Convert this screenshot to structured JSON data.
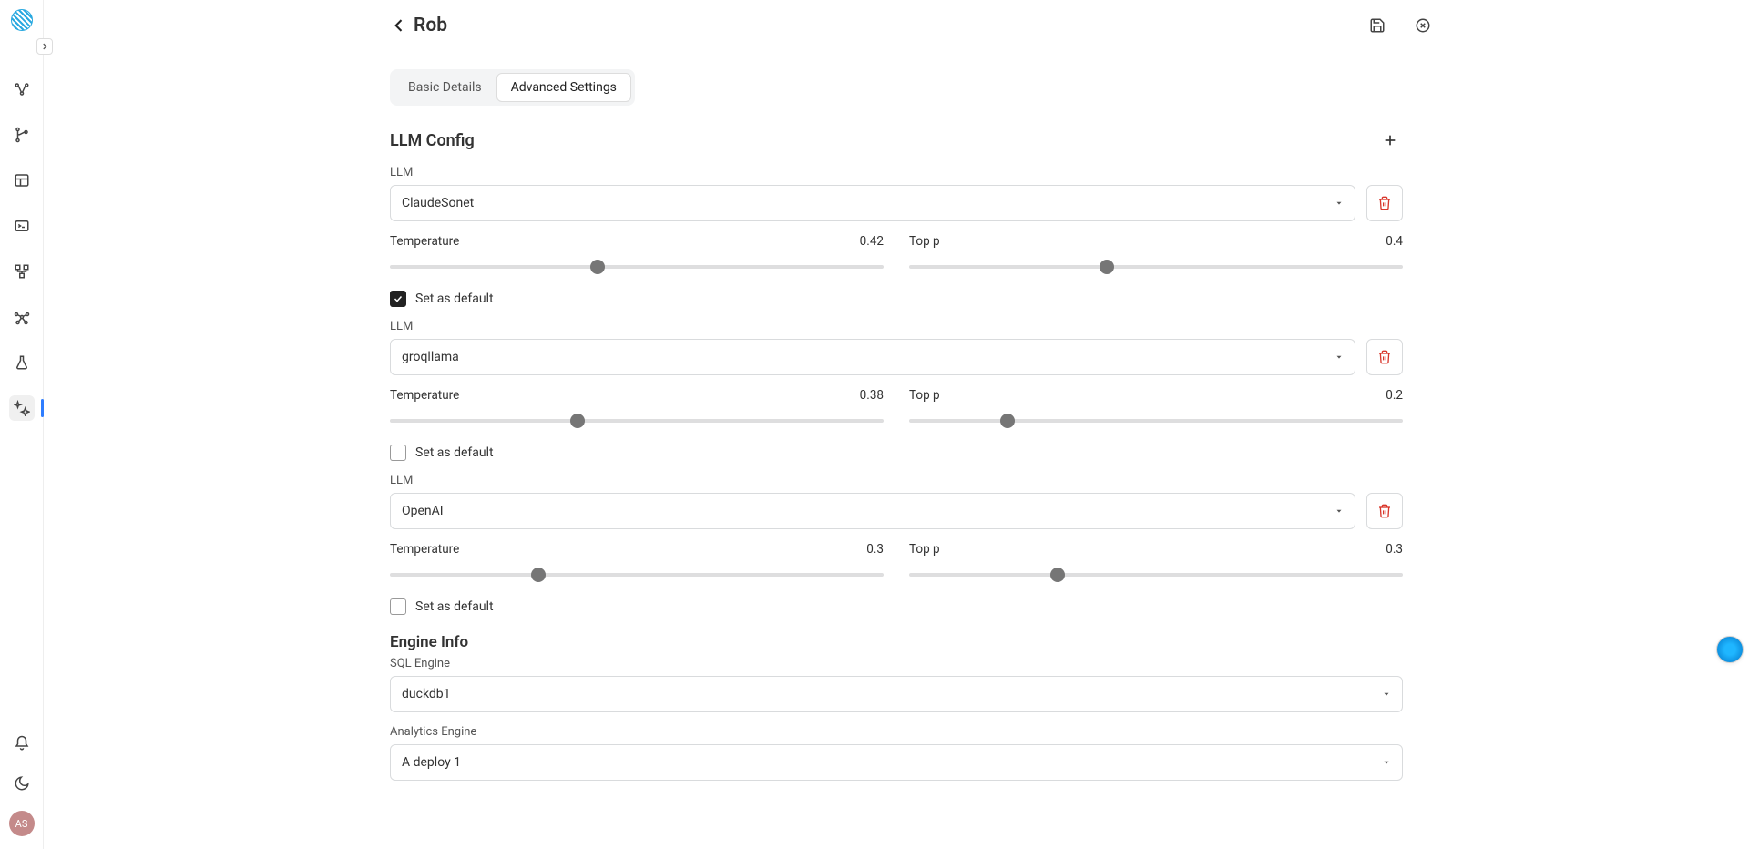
{
  "sidebar": {
    "avatar_initials": "AS"
  },
  "header": {
    "title": "Rob"
  },
  "tabs": {
    "basic": "Basic Details",
    "advanced": "Advanced Settings"
  },
  "llm_section": {
    "title": "LLM Config",
    "llm_label": "LLM",
    "temperature_label": "Temperature",
    "topp_label": "Top p",
    "default_label": "Set as default",
    "items": [
      {
        "name": "ClaudeSonet",
        "temperature": "0.42",
        "top_p": "0.4",
        "temp_pct": 42,
        "topp_pct": 40,
        "is_default": true
      },
      {
        "name": "groqllama",
        "temperature": "0.38",
        "top_p": "0.2",
        "temp_pct": 38,
        "topp_pct": 20,
        "is_default": false
      },
      {
        "name": "OpenAI",
        "temperature": "0.3",
        "top_p": "0.3",
        "temp_pct": 30,
        "topp_pct": 30,
        "is_default": false
      }
    ]
  },
  "engine_section": {
    "title": "Engine Info",
    "sql_label": "SQL Engine",
    "sql_value": "duckdb1",
    "analytics_label": "Analytics Engine",
    "analytics_value": "A deploy 1"
  }
}
